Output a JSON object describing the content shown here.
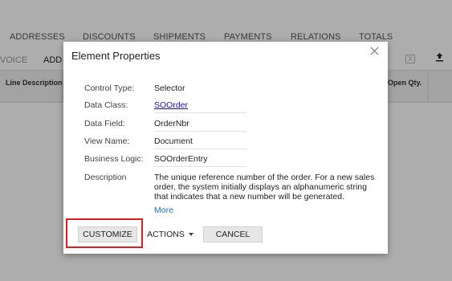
{
  "tabs": [
    "ADDRESSES",
    "DISCOUNTS",
    "SHIPMENTS",
    "PAYMENTS",
    "RELATIONS",
    "TOTALS"
  ],
  "toolbar": {
    "invoice_label": "VOICE",
    "add_label": "ADD",
    "excel_icon": "X"
  },
  "grid": {
    "col_line_description": "Line Description",
    "col_open_qty": "Open Qty."
  },
  "dialog": {
    "title": "Element Properties",
    "properties": [
      {
        "label": "Control Type:",
        "value": "Selector"
      },
      {
        "label": "Data Class:",
        "value": "SOOrder"
      },
      {
        "label": "Data Field:",
        "value": "OrderNbr"
      },
      {
        "label": "View Name:",
        "value": "Document"
      },
      {
        "label": "Business Logic:",
        "value": "SOOrderEntry"
      }
    ],
    "description_label": "Description",
    "description_text": "The unique reference number of the order. For a new sales order, the system initially displays an alphanumeric string that indicates that a new number will be generated.",
    "more_label": "More",
    "buttons": {
      "customize": "CUSTOMIZE",
      "actions": "ACTIONS",
      "cancel": "CANCEL"
    }
  },
  "colors": {
    "highlight": "#e11b22",
    "link": "#1a0dab",
    "more_link": "#1f6fc2"
  }
}
